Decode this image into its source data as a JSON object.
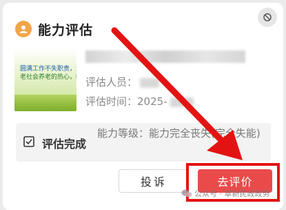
{
  "card": {
    "title": "能力评估",
    "info": {
      "people_label": "评估人员：",
      "time_label": "评估时间：",
      "time_value": "2025-"
    },
    "thumbnail": {
      "line1": "圆满工作不失职责，温情回心，",
      "line2": "老社会养老的热心，暖暖工作"
    },
    "status": {
      "label": "评估完成",
      "level_text": "能力等级：能力完全丧失(完全失能)"
    },
    "buttons": {
      "complain": "投诉",
      "evaluate": "去评价"
    }
  },
  "watermark": "公众号 · 阜新民政政务",
  "colors": {
    "accent_red": "#e94b4b",
    "highlight_red": "#e41313",
    "header_icon": "#f2a54a"
  }
}
